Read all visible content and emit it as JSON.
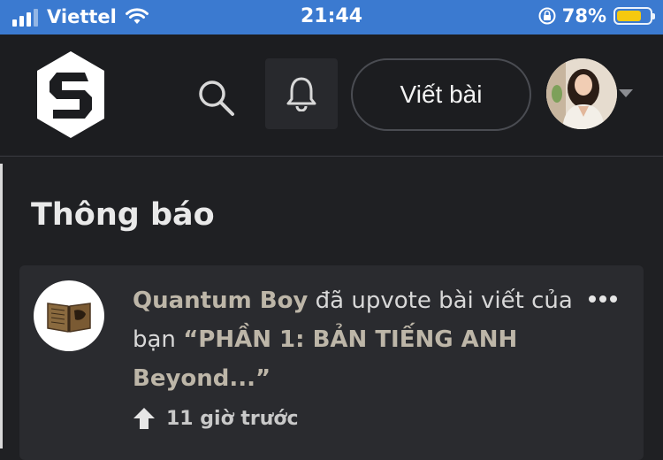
{
  "status_bar": {
    "carrier": "Viettel",
    "time": "21:44",
    "battery_percent": "78%",
    "battery_level": 0.78,
    "icons": [
      "signal-icon",
      "wifi-icon",
      "orientation-lock-icon",
      "battery-icon"
    ]
  },
  "header": {
    "logo": "logo-icon",
    "search_icon": "search-icon",
    "bell_icon": "bell-icon",
    "write_label": "Viết bài",
    "caret_icon": "chevron-down-icon"
  },
  "page": {
    "title": "Thông báo"
  },
  "notifications": [
    {
      "actor": "Quantum Boy",
      "action": " đã upvote bài viết của bạn ",
      "post_title": "“PHẦN 1: BẢN TIẾNG ANH Beyond...”",
      "time_ago": "11 giờ trước",
      "icon": "upvote-arrow-icon",
      "avatar_icon": "book-icon"
    }
  ],
  "colors": {
    "status_bar": "#3b7ad0",
    "background": "#1f2023",
    "card": "#2a2b2f",
    "battery": "#f5c90f"
  }
}
